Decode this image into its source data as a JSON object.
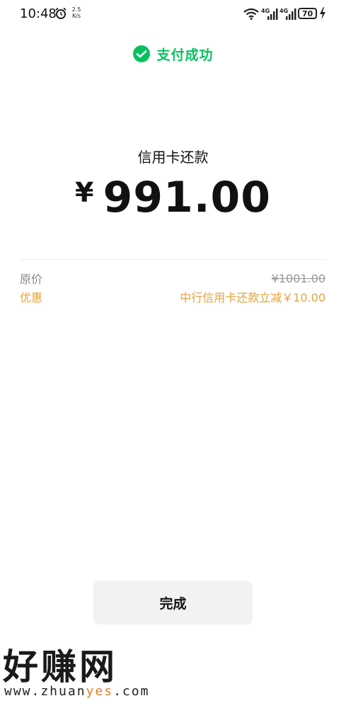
{
  "status_bar": {
    "time": "10:48",
    "net_speed_value": "2.5",
    "net_speed_unit": "K/s",
    "network_1": "4G",
    "network_2": "4G",
    "battery": "70",
    "icons": [
      "alarm-icon",
      "wifi-icon",
      "signal-icon",
      "signal-icon",
      "battery-icon",
      "charging-bolt-icon"
    ]
  },
  "header": {
    "status_text": "支付成功",
    "status_icon": "wechat-pay-icon",
    "accent_color": "#07c160"
  },
  "payment": {
    "title": "信用卡还款",
    "currency_symbol": "¥",
    "amount": "991.00"
  },
  "details": {
    "original_label": "原价",
    "original_value": "¥1001.00",
    "discount_label": "优惠",
    "discount_value": "中行信用卡还款立减￥10.00",
    "discount_color": "#e6a23c"
  },
  "actions": {
    "done_label": "完成"
  },
  "watermark": {
    "logo_text": "好赚网",
    "url_prefix": "www.zhuan",
    "url_highlight": "yes",
    "url_suffix": ".com"
  }
}
